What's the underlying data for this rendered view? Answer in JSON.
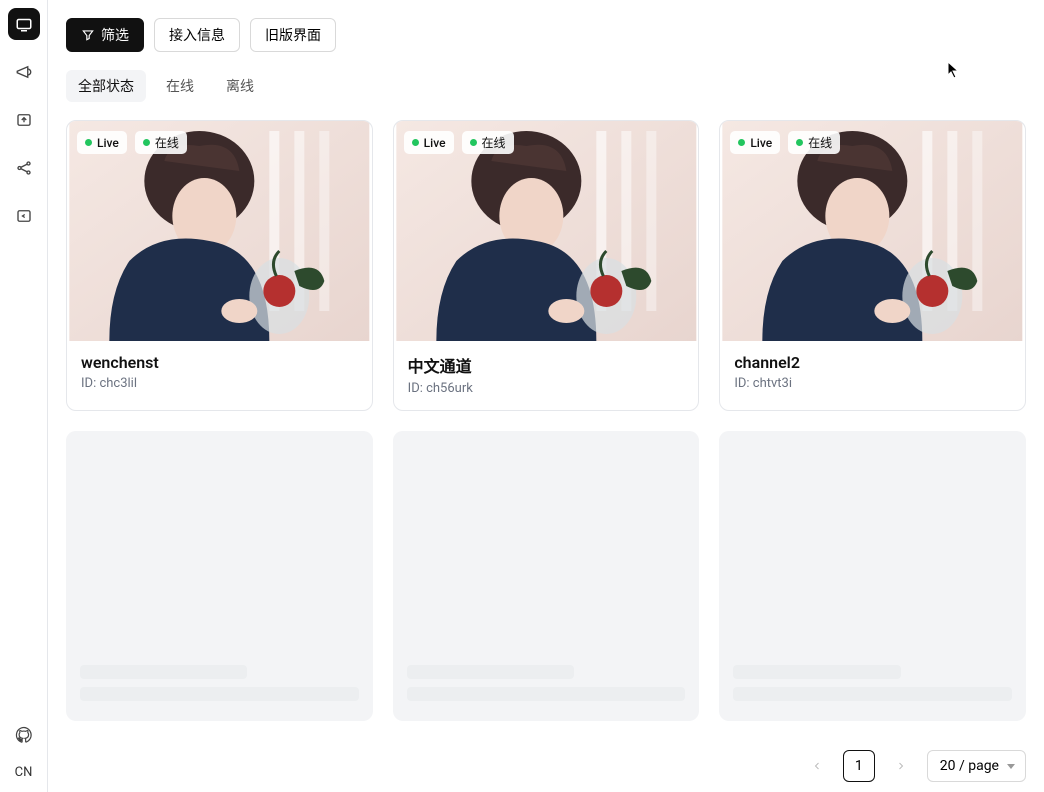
{
  "sidebar": {
    "lang": "CN"
  },
  "toolbar": {
    "filter": "筛选",
    "access": "接入信息",
    "legacy": "旧版界面"
  },
  "tabs": {
    "all": "全部状态",
    "online": "在线",
    "offline": "离线"
  },
  "badges": {
    "live": "Live",
    "online": "在线"
  },
  "cards": [
    {
      "title": "wenchenst",
      "id": "ID: chc3lil"
    },
    {
      "title": "中文通道",
      "id": "ID: ch56urk"
    },
    {
      "title": "channel2",
      "id": "ID: chtvt3i"
    }
  ],
  "pagination": {
    "current": "1",
    "pageSize": "20 / page"
  }
}
